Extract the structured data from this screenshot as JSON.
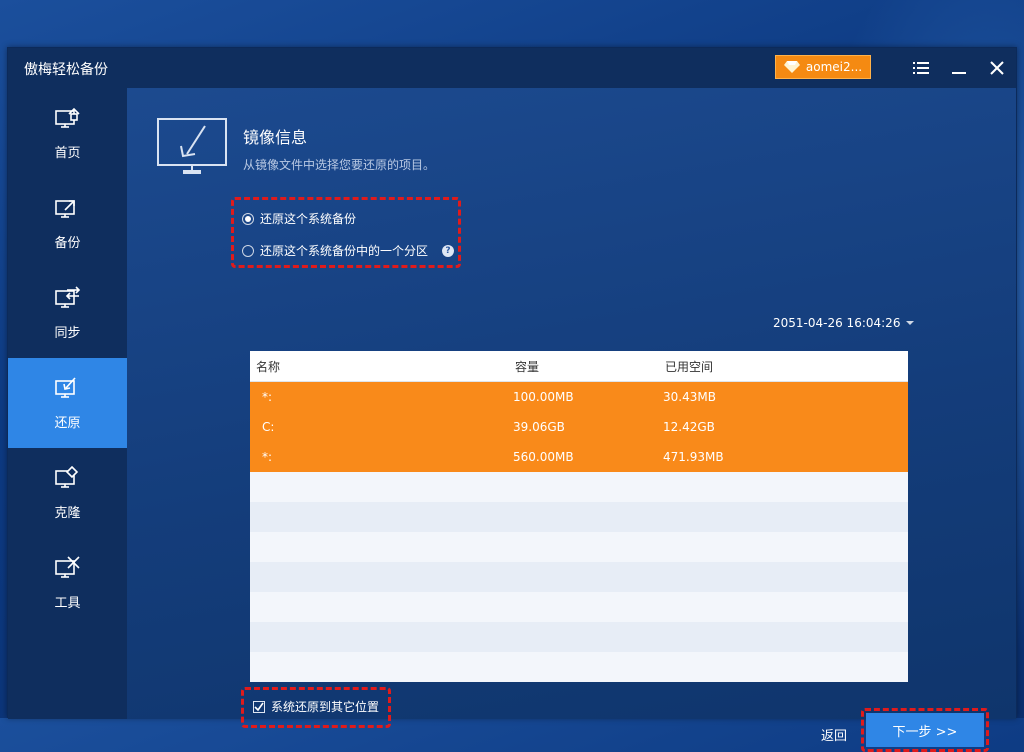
{
  "app": {
    "title": "傲梅轻松备份"
  },
  "titlebar": {
    "user_badge": "aomei2...",
    "menu_icon": "list-menu-icon",
    "minimize_icon": "minimize-icon",
    "close_icon": "close-icon"
  },
  "sidebar": {
    "items": [
      {
        "label": "首页",
        "icon": "home-icon",
        "active": false
      },
      {
        "label": "备份",
        "icon": "backup-icon",
        "active": false
      },
      {
        "label": "同步",
        "icon": "sync-icon",
        "active": false
      },
      {
        "label": "还原",
        "icon": "restore-icon",
        "active": true
      },
      {
        "label": "克隆",
        "icon": "clone-icon",
        "active": false
      },
      {
        "label": "工具",
        "icon": "tools-icon",
        "active": false
      }
    ]
  },
  "main": {
    "title": "镜像信息",
    "subtitle": "从镜像文件中选择您要还原的项目。",
    "options": [
      {
        "label": "还原这个系统备份",
        "checked": true
      },
      {
        "label": "还原这个系统备份中的一个分区",
        "checked": false
      }
    ],
    "timestamp": "2051-04-26 16:04:26",
    "table": {
      "headers": [
        "名称",
        "容量",
        "已用空间"
      ],
      "rows": [
        [
          "*:",
          "100.00MB",
          "30.43MB"
        ],
        [
          "C:",
          "39.06GB",
          "12.42GB"
        ],
        [
          "*:",
          "560.00MB",
          "471.93MB"
        ]
      ]
    },
    "restore_other_location": {
      "label": "系统还原到其它位置",
      "checked": true
    },
    "back_label": "返回",
    "next_label": "下一步 >>"
  },
  "colors": {
    "accent": "#2f86e6",
    "selected_row": "#f98a1a",
    "highlight_dashes": "#e01b1b",
    "badge": "#f58a12"
  }
}
